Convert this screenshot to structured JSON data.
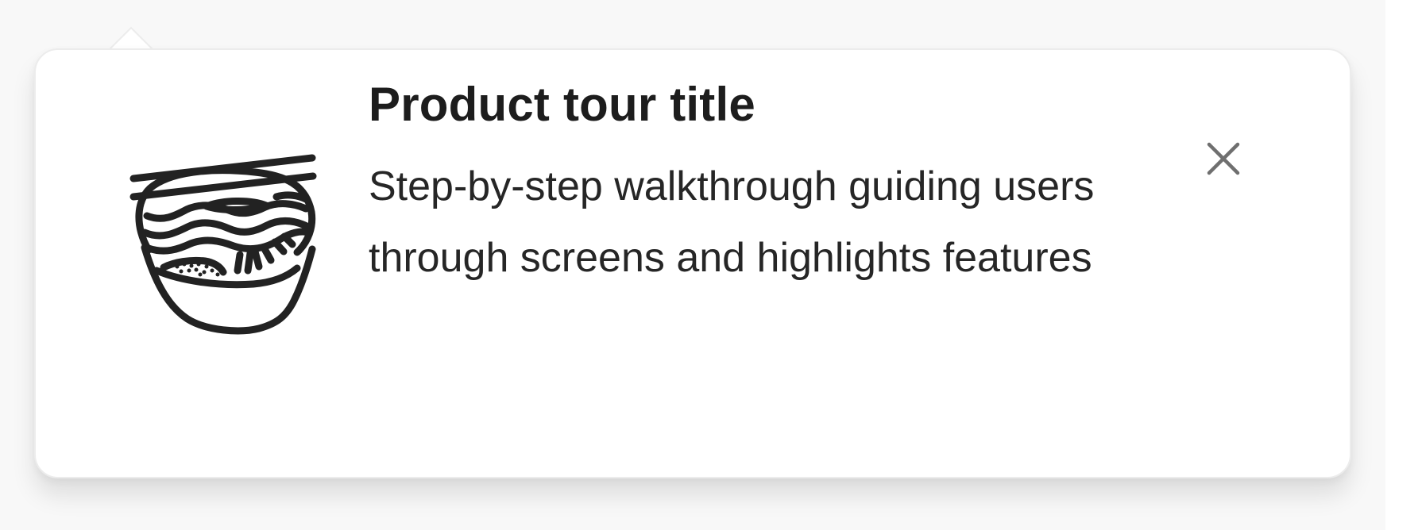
{
  "product_tour": {
    "title": "Product tour title",
    "description": "Step-by-step walkthrough guiding users through screens and highlights features",
    "illustration": "noodle-bowl-icon",
    "close_icon": "close-icon"
  },
  "colors": {
    "backdrop": "#f8f8f8",
    "card_background": "#ffffff",
    "card_border": "#ececec",
    "title_text": "#1d1d1d",
    "body_text": "#262626",
    "illustration_stroke": "#222222",
    "close_icon": "#6f6f6f"
  }
}
